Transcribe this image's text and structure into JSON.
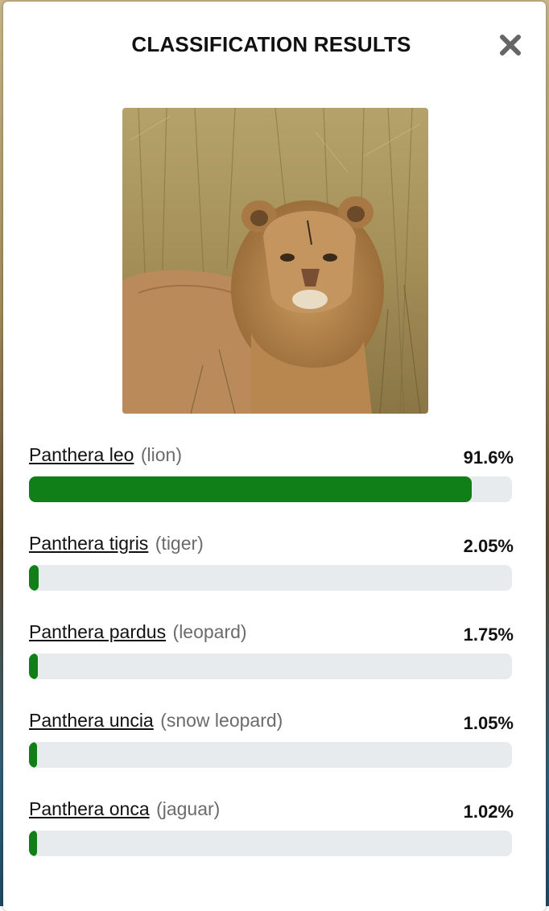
{
  "dialog": {
    "title": "CLASSIFICATION RESULTS",
    "close_icon": "close-icon"
  },
  "image": {
    "subject": "lion standing in dry grass"
  },
  "colors": {
    "bar_fill": "#117f17",
    "bar_track": "#e8ebee"
  },
  "results": [
    {
      "scientific": "Panthera leo",
      "common": "(lion)",
      "percent": "91.6%",
      "value": 91.6
    },
    {
      "scientific": "Panthera tigris",
      "common": "(tiger)",
      "percent": "2.05%",
      "value": 2.05
    },
    {
      "scientific": "Panthera pardus",
      "common": "(leopard)",
      "percent": "1.75%",
      "value": 1.75
    },
    {
      "scientific": "Panthera uncia",
      "common": "(snow leopard)",
      "percent": "1.05%",
      "value": 1.05
    },
    {
      "scientific": "Panthera onca",
      "common": "(jaguar)",
      "percent": "1.02%",
      "value": 1.02
    }
  ]
}
